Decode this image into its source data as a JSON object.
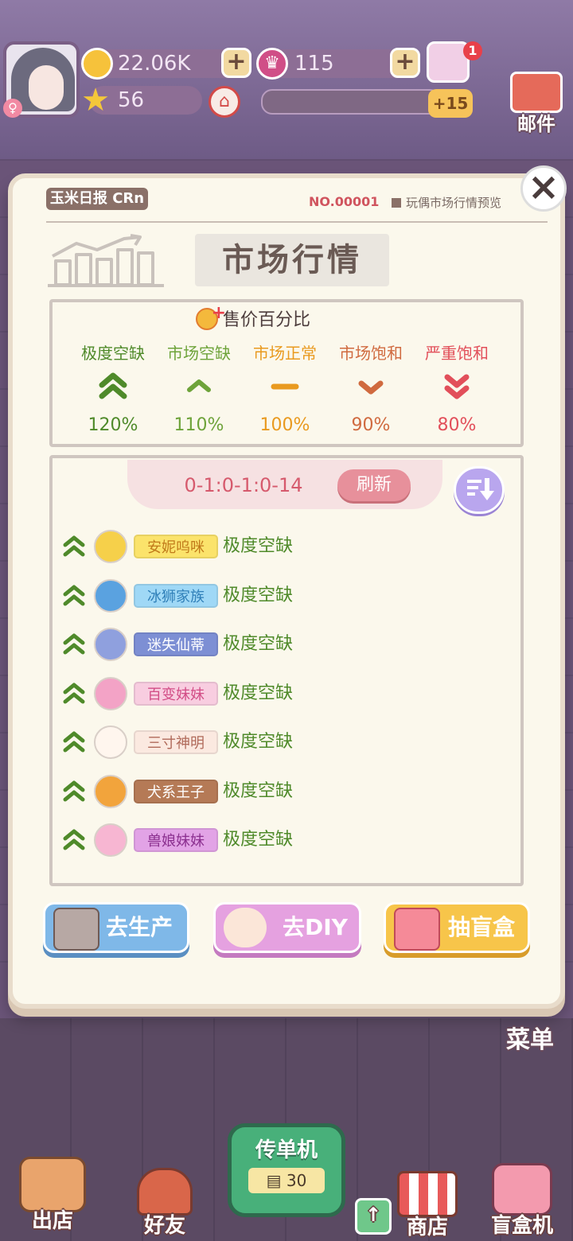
{
  "hud": {
    "coins": "22.06K",
    "crowns": "115",
    "stars": "56",
    "exp_badge": "+15",
    "npc_badge": "1"
  },
  "side": {
    "mail_label": "邮件",
    "menu_label": "菜单"
  },
  "paper": {
    "logo": "玉米日报 CRn",
    "issue_no": "NO.00001",
    "preview_label": "玩偶市场行情预览",
    "title": "市场行情",
    "legend_title": "售价百分比"
  },
  "legend": [
    {
      "label": "极度空缺",
      "pct": "120%",
      "color": "#4f8a2a",
      "arrow": "double-up"
    },
    {
      "label": "市场空缺",
      "pct": "110%",
      "color": "#6ea33a",
      "arrow": "up"
    },
    {
      "label": "市场正常",
      "pct": "100%",
      "color": "#e99a1f",
      "arrow": "dash"
    },
    {
      "label": "市场饱和",
      "pct": "90%",
      "color": "#d06a3f",
      "arrow": "down"
    },
    {
      "label": "严重饱和",
      "pct": "80%",
      "color": "#e24f5a",
      "arrow": "double-down"
    }
  ],
  "list": {
    "date": "0-1:0-1:0-14",
    "refresh_label": "刷新",
    "items": [
      {
        "name": "安妮呜咪",
        "status": "极度空缺",
        "tag_bg": "#fbe36b",
        "tag_fg": "#c17a1a",
        "icon_color": "#f6d04a",
        "icon": "pear-icon"
      },
      {
        "name": "冰狮家族",
        "status": "极度空缺",
        "tag_bg": "#9fd8f6",
        "tag_fg": "#2f7fb8",
        "icon_color": "#5aa2e0",
        "icon": "paw-shield-icon"
      },
      {
        "name": "迷失仙蒂",
        "status": "极度空缺",
        "tag_bg": "#7d8fd4",
        "tag_fg": "#ffffff",
        "icon_color": "#8fa0de",
        "icon": "crystal-icon"
      },
      {
        "name": "百变妹妹",
        "status": "极度空缺",
        "tag_bg": "#f8cde0",
        "tag_fg": "#d24d86",
        "icon_color": "#f3a3c6",
        "icon": "heart-icon"
      },
      {
        "name": "三寸神明",
        "status": "极度空缺",
        "tag_bg": "#fbe9e0",
        "tag_fg": "#b06a5a",
        "icon_color": "#fff6ee",
        "icon": "face-icon"
      },
      {
        "name": "犬系王子",
        "status": "极度空缺",
        "tag_bg": "#b57a56",
        "tag_fg": "#ffffff",
        "icon_color": "#f2a43c",
        "icon": "swirl-icon"
      },
      {
        "name": "兽娘妹妹",
        "status": "极度空缺",
        "tag_bg": "#e2a3e6",
        "tag_fg": "#8b2f8f",
        "icon_color": "#f7b6d2",
        "icon": "paw-icon"
      }
    ]
  },
  "buttons": {
    "produce": "去生产",
    "diy": "去DIY",
    "blindbox": "抽盲盒"
  },
  "nav": {
    "shop_out": "出店",
    "friends": "好友",
    "flyer": "传单机",
    "flyer_count": "30",
    "store": "商店",
    "blindbox_machine": "盲盒机"
  }
}
